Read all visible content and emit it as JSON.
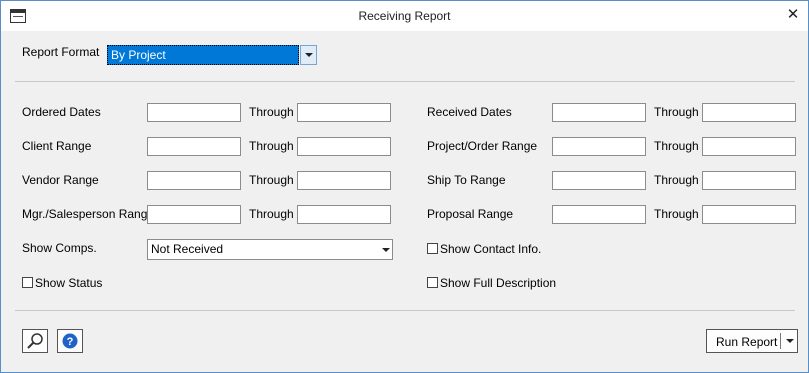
{
  "window": {
    "title": "Receiving Report",
    "close_glyph": "✕"
  },
  "report_format": {
    "label": "Report Format",
    "value": "By Project"
  },
  "ranges": {
    "through": "Through",
    "ordered_dates": "Ordered Dates",
    "client_range": "Client Range",
    "vendor_range": "Vendor Range",
    "mgr_salesperson_range": "Mgr./Salesperson Range",
    "received_dates": "Received Dates",
    "project_order_range": "Project/Order Range",
    "ship_to_range": "Ship To Range",
    "proposal_range": "Proposal Range"
  },
  "show_comps": {
    "label": "Show Comps.",
    "value": "Not Received"
  },
  "checkboxes": {
    "show_status": {
      "label": "Show Status",
      "checked": false
    },
    "show_contact_info": {
      "label": "Show Contact Info.",
      "checked": false
    },
    "show_full_description": {
      "label": "Show Full Description",
      "checked": false
    }
  },
  "footer": {
    "run_report_label": "Run Report"
  },
  "icons": [
    "window-icon",
    "close-icon",
    "dropdown-arrow-icon",
    "search-icon",
    "help-icon"
  ],
  "colors": {
    "selection": "#0078d7",
    "help_blue": "#1e64c8",
    "border": "#5a8ec8"
  }
}
